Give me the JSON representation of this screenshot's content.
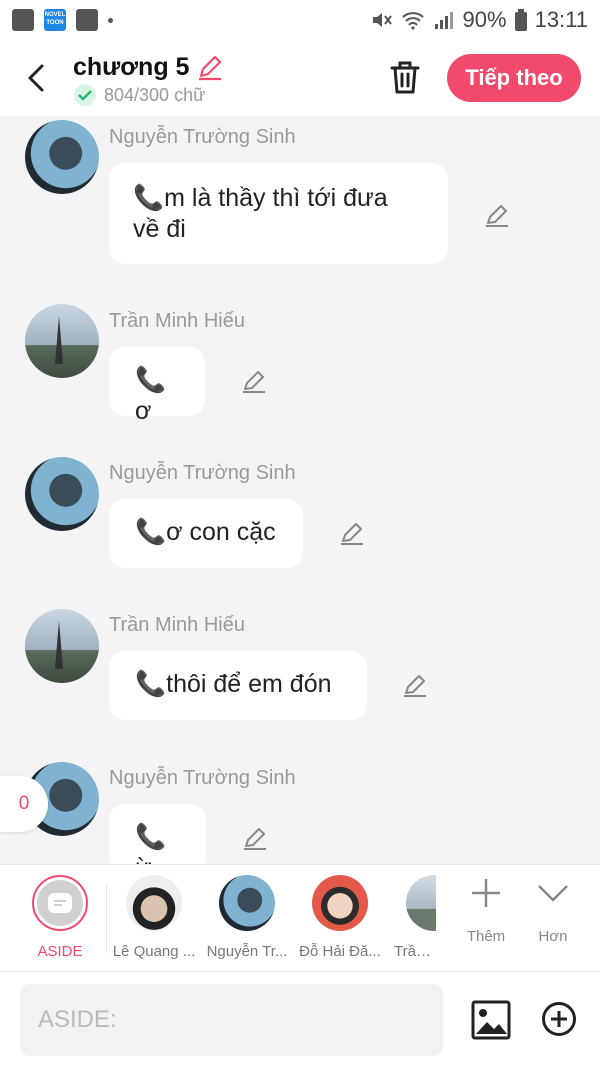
{
  "statusbar": {
    "battery": "90%",
    "time": "13:11",
    "app_icon_label": "NOVEL TOON"
  },
  "header": {
    "title": "chương 5",
    "wordcount": "804/300 chữ",
    "next_label": "Tiếp theo"
  },
  "messages": [
    {
      "sender": "Nguyễn Trường Sinh",
      "text_line1": "📞m là thầy thì tới đưa",
      "text_line2": "về đi"
    },
    {
      "sender": "Trần Minh Hiếu",
      "text": "📞ơ"
    },
    {
      "sender": "Nguyễn Trường Sinh",
      "text": "📞ơ con cặc"
    },
    {
      "sender": "Trần Minh Hiếu",
      "text": "📞thôi để em đón"
    },
    {
      "sender": "Nguyễn Trường Sinh",
      "text": "📞ừ"
    }
  ],
  "counter": "0",
  "characters": [
    {
      "name": "ASIDE"
    },
    {
      "name": "Lê Quang ..."
    },
    {
      "name": "Nguyễn Tr..."
    },
    {
      "name": "Đỗ Hải Đă..."
    },
    {
      "name": "Trần M"
    }
  ],
  "tools": {
    "more_label": "Thêm",
    "less_label": "Hơn"
  },
  "input": {
    "placeholder": "ASIDE:"
  },
  "colors": {
    "accent": "#f24a6c",
    "background": "#f4f4f6",
    "bubble": "#ffffff"
  }
}
